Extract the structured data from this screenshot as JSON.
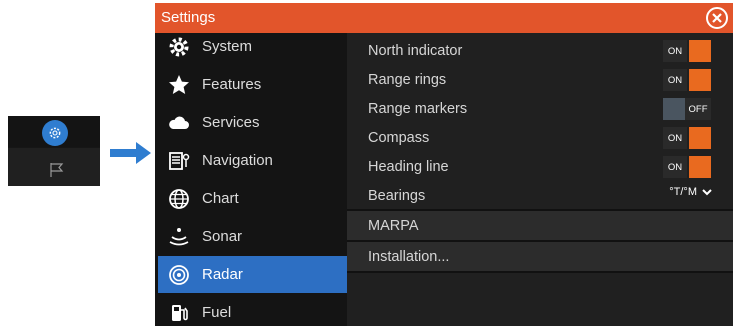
{
  "window": {
    "title": "Settings",
    "accent_color": "#e2552b",
    "close_icon": "close-icon"
  },
  "sidebar": {
    "selection_color": "#2d6fc3",
    "items": [
      {
        "label": "System",
        "icon": "gear-icon"
      },
      {
        "label": "Features",
        "icon": "star-icon"
      },
      {
        "label": "Services",
        "icon": "cloud-icon"
      },
      {
        "label": "Navigation",
        "icon": "navigation-icon"
      },
      {
        "label": "Chart",
        "icon": "globe-icon"
      },
      {
        "label": "Sonar",
        "icon": "sonar-icon"
      },
      {
        "label": "Radar",
        "icon": "radar-icon"
      },
      {
        "label": "Fuel",
        "icon": "fuel-pump-icon"
      }
    ],
    "selected": "Radar"
  },
  "radar_settings": {
    "north_indicator": {
      "label": "North indicator",
      "state": "ON"
    },
    "range_rings": {
      "label": "Range rings",
      "state": "ON"
    },
    "range_markers": {
      "label": "Range markers",
      "state": "OFF"
    },
    "compass": {
      "label": "Compass",
      "state": "ON"
    },
    "heading_line": {
      "label": "Heading line",
      "state": "ON"
    },
    "bearings": {
      "label": "Bearings",
      "value": "°T/°M"
    },
    "marpa": {
      "label": "MARPA"
    },
    "installation": {
      "label": "Installation..."
    }
  },
  "toggle_on_color": "#e96a1f"
}
